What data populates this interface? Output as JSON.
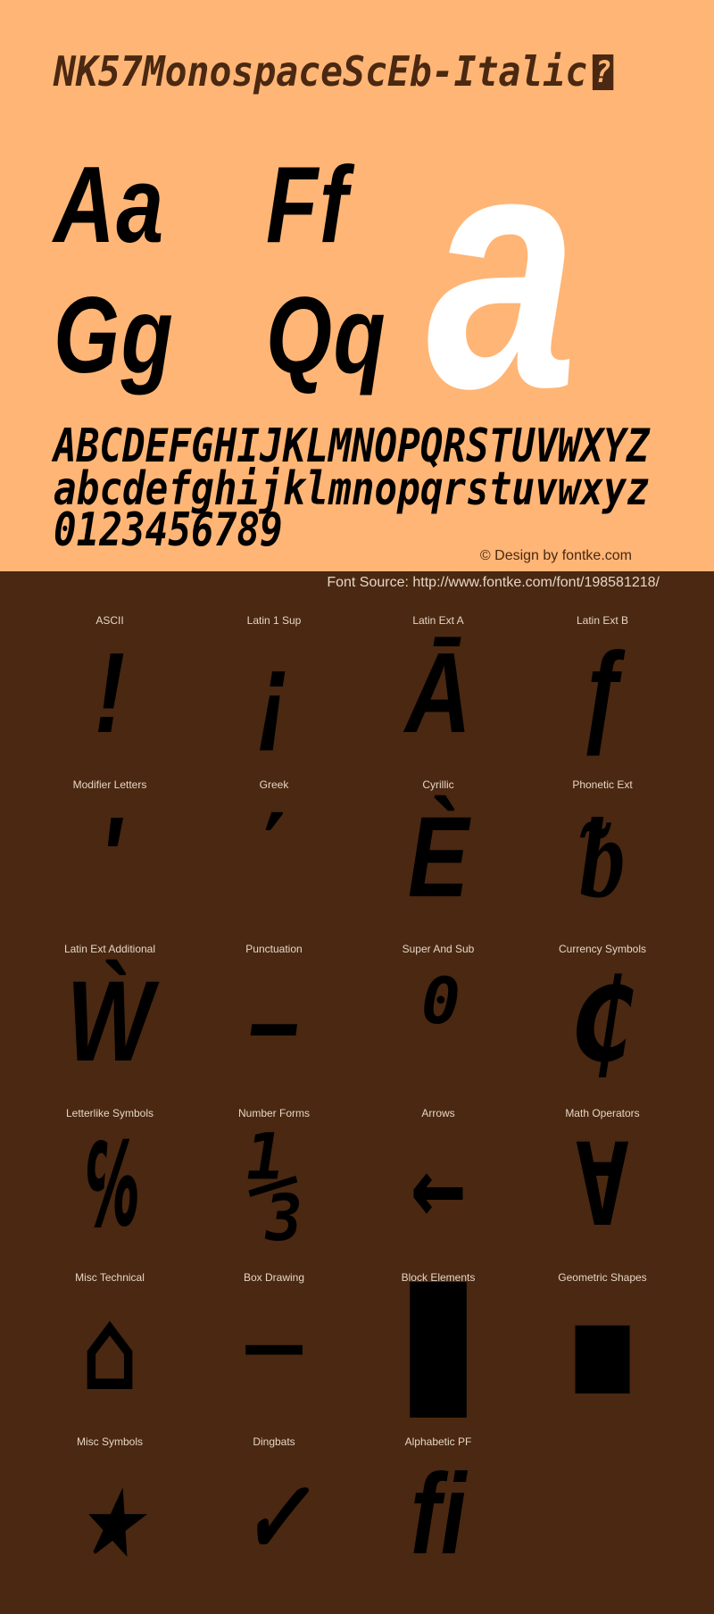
{
  "header": {
    "title": "NK57MonospaceScEb-Italic",
    "missing_glyph": "?"
  },
  "specimen": {
    "pairs": [
      "Aa",
      "Ff",
      "Gg",
      "Qq"
    ],
    "hero_glyph": "a",
    "uppercase": "ABCDEFGHIJKLMNOPQRSTUVWXYZ",
    "lowercase": "abcdefghijklmnopqrstuvwxyz",
    "digits": "0123456789"
  },
  "credit": "© Design by fontke.com",
  "source": "Font Source: http://www.fontke.com/font/198581218/",
  "colors": {
    "top_background": "#ffb575",
    "bottom_background": "#4a2811",
    "glyph": "#000000",
    "hero_glyph": "#ffffff",
    "label_text": "#e6d6c6"
  },
  "blocks": [
    {
      "label": "ASCII",
      "glyph": "!"
    },
    {
      "label": "Latin 1 Sup",
      "glyph": "¡"
    },
    {
      "label": "Latin Ext A",
      "glyph": "Ā"
    },
    {
      "label": "Latin Ext B",
      "glyph": "ƒ"
    },
    {
      "label": "Modifier Letters",
      "glyph": "ʹ"
    },
    {
      "label": "Greek",
      "glyph": "΄"
    },
    {
      "label": "Cyrillic",
      "glyph": "Ѐ"
    },
    {
      "label": "Phonetic Ext",
      "glyph": "ᵬ"
    },
    {
      "label": "Latin Ext Additional",
      "glyph": "Ẁ"
    },
    {
      "label": "Punctuation",
      "glyph": "–"
    },
    {
      "label": "Super And Sub",
      "glyph": "⁰"
    },
    {
      "label": "Currency Symbols",
      "glyph": "₵"
    },
    {
      "label": "Letterlike Symbols",
      "glyph": "℅"
    },
    {
      "label": "Number Forms",
      "glyph": "⅓"
    },
    {
      "label": "Arrows",
      "glyph": "←"
    },
    {
      "label": "Math Operators",
      "glyph": "∀"
    },
    {
      "label": "Misc Technical",
      "glyph": "⌂"
    },
    {
      "label": "Box Drawing",
      "glyph": "─"
    },
    {
      "label": "Block Elements",
      "glyph": "█"
    },
    {
      "label": "Geometric Shapes",
      "glyph": "■"
    },
    {
      "label": "Misc Symbols",
      "glyph": "★"
    },
    {
      "label": "Dingbats",
      "glyph": "✓"
    },
    {
      "label": "Alphabetic PF",
      "glyph": "ﬁ"
    }
  ]
}
